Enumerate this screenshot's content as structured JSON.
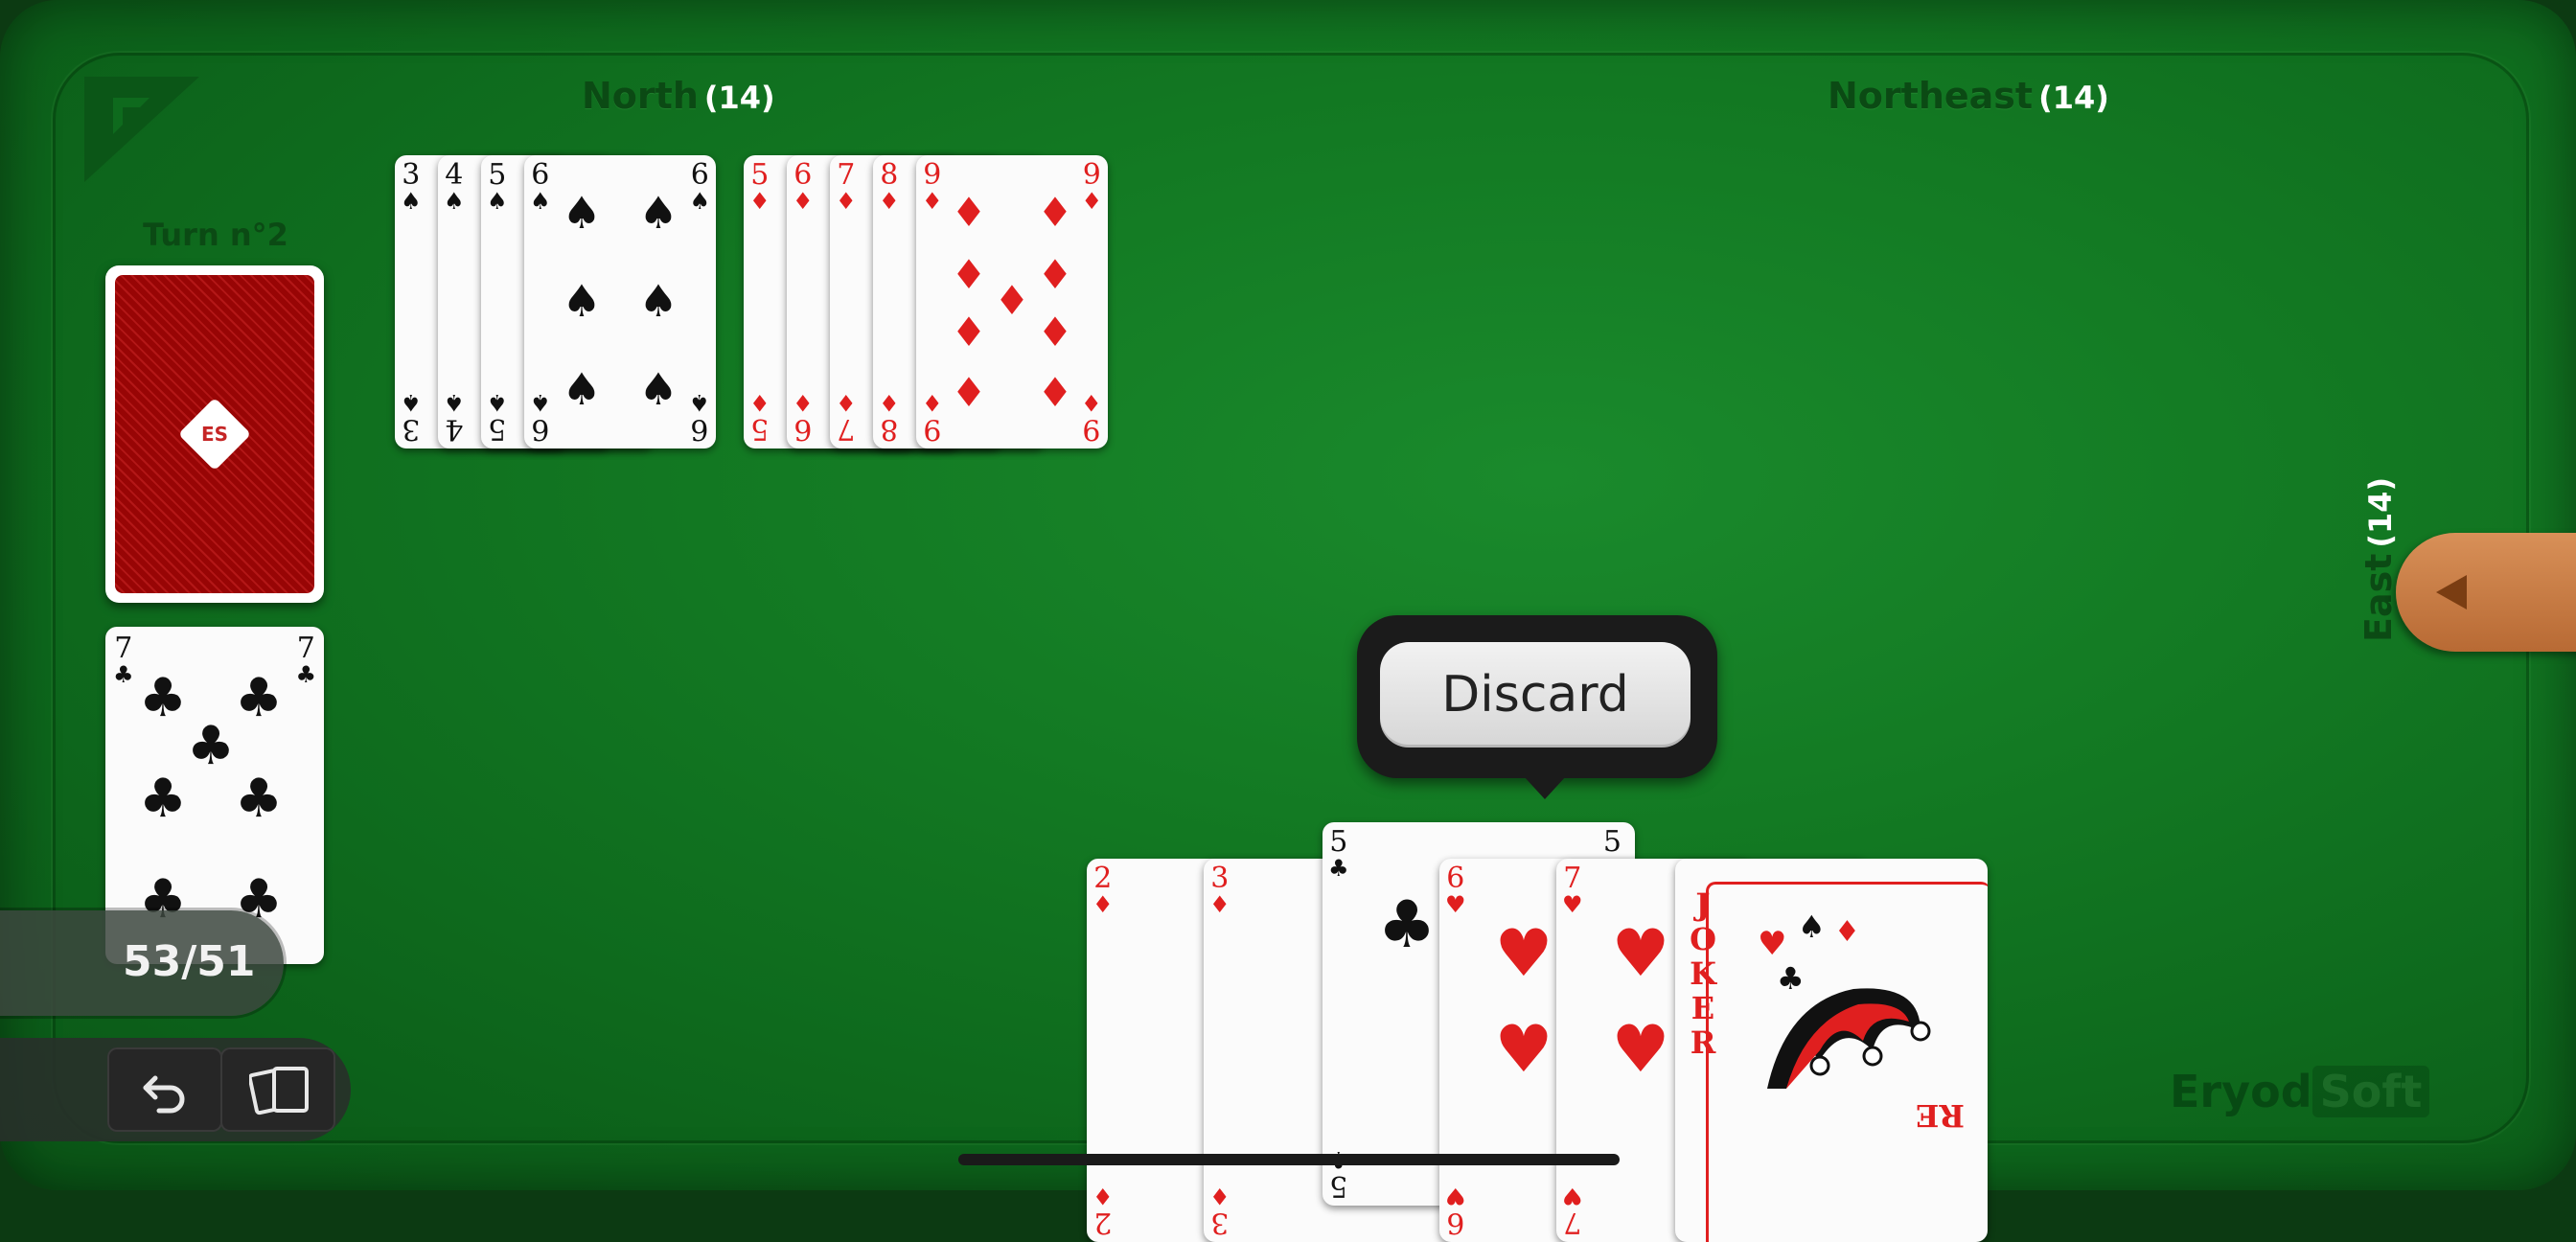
{
  "players": {
    "north": {
      "name": "North",
      "count": "(14)"
    },
    "northeast": {
      "name": "Northeast",
      "count": "(14)"
    },
    "east": {
      "name": "East",
      "count": "(14)"
    }
  },
  "turn_label": "Turn n°2",
  "deck_back_emblem": "ES",
  "discard_top": {
    "rank": "7",
    "suit": "♣"
  },
  "meld_spades": [
    {
      "rank": "3",
      "suit": "♠"
    },
    {
      "rank": "4",
      "suit": "♠"
    },
    {
      "rank": "5",
      "suit": "♠"
    },
    {
      "rank": "6",
      "suit": "♠"
    }
  ],
  "meld_diamonds": [
    {
      "rank": "5",
      "suit": "♦"
    },
    {
      "rank": "6",
      "suit": "♦"
    },
    {
      "rank": "7",
      "suit": "♦"
    },
    {
      "rank": "8",
      "suit": "♦"
    },
    {
      "rank": "9",
      "suit": "♦"
    }
  ],
  "hand": [
    {
      "rank": "2",
      "suit": "♦"
    },
    {
      "rank": "3",
      "suit": "♦"
    },
    {
      "rank": "5",
      "suit": "♣"
    },
    {
      "rank": "6",
      "suit": "♥"
    },
    {
      "rank": "7",
      "suit": "♥"
    }
  ],
  "joker": {
    "text": "JOKER",
    "mirror_text": "RE"
  },
  "counter": "53/51",
  "discard_button": "Discard",
  "watermark": {
    "part1": "Eryod",
    "part2": "Soft"
  },
  "icons": {
    "undo": "undo-icon",
    "cards": "cards-icon",
    "panel_toggle": "triangle-left-icon",
    "logo": "corner-logo-icon"
  },
  "colors": {
    "felt": "#137a23",
    "card_red": "#e01f1f",
    "card_back": "#c52525",
    "tab_wood": "#c97a40"
  }
}
